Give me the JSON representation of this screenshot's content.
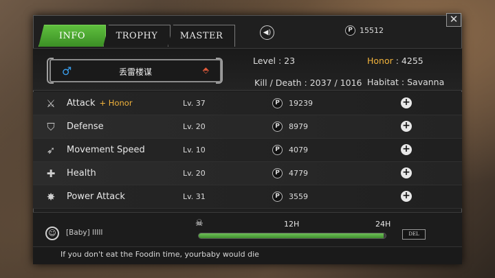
{
  "tabs": [
    {
      "label": "INFO",
      "active": true
    },
    {
      "label": "TROPHY",
      "active": false
    },
    {
      "label": "MASTER",
      "active": false
    }
  ],
  "currency": {
    "icon": "P",
    "amount": "15512"
  },
  "player": {
    "name": "丢雷楼谋",
    "gender_icon": "♂",
    "level_label": "Level : 23",
    "honor_label": "Honor",
    "honor_value": ": 4255",
    "kd_label": "Kill / Death : 2037 / 1016",
    "habitat_label": "Habitat :",
    "habitat_value": "Savanna"
  },
  "skills": [
    {
      "icon": "attack-icon",
      "name": "Attack",
      "bonus": "+ Honor",
      "level": "Lv. 37",
      "cost": "19239"
    },
    {
      "icon": "shield-icon",
      "name": "Defense",
      "bonus": "",
      "level": "Lv. 20",
      "cost": "8979"
    },
    {
      "icon": "wing-icon",
      "name": "Movement Speed",
      "bonus": "",
      "level": "Lv. 10",
      "cost": "4079"
    },
    {
      "icon": "health-cross-icon",
      "name": "Health",
      "bonus": "",
      "level": "Lv. 20",
      "cost": "4779"
    },
    {
      "icon": "burst-icon",
      "name": "Power Attack",
      "bonus": "",
      "level": "Lv. 31",
      "cost": "3559"
    }
  ],
  "baby": {
    "label": "[Baby] IIIII",
    "tick_12": "12H",
    "tick_24": "24H",
    "progress_fraction": 0.99,
    "delete_label": "DEL"
  },
  "footer_message": "If you don't eat the Foodin time, yourbaby would die",
  "colors": {
    "accent_green": "#4fa832",
    "honor_gold": "#f3b43c",
    "gender_blue": "#3aa0f0"
  }
}
